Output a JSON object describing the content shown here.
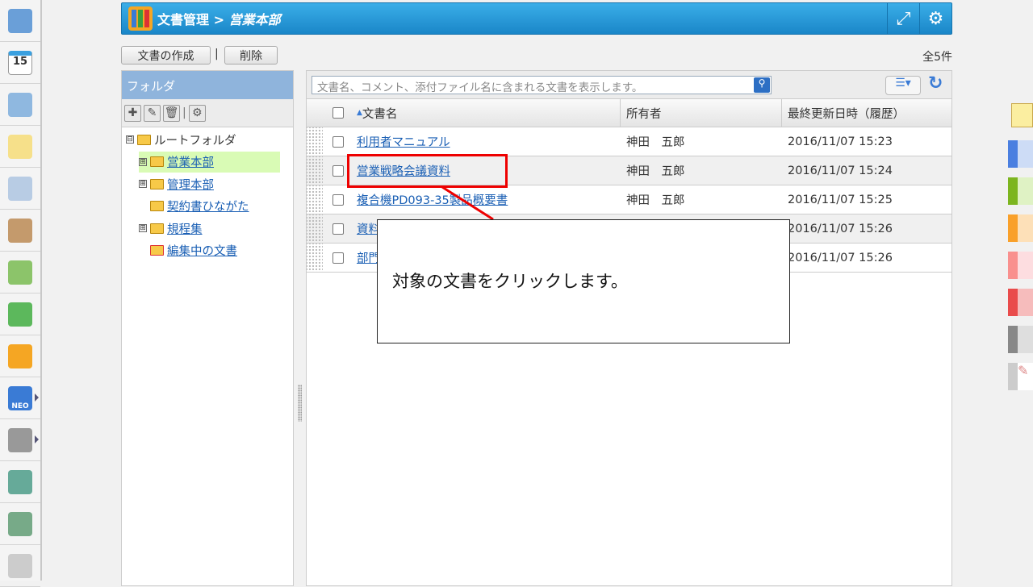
{
  "dock": {
    "icons": [
      "portal-icon",
      "calendar-icon",
      "projector-icon",
      "memo-icon",
      "bulletin-icon",
      "clipboard-icon",
      "todo-icon",
      "workflow-icon",
      "document-binder-icon",
      "neo-icon",
      "folder-icon",
      "nanomail-icon",
      "image-icon",
      "gear-icon"
    ],
    "calendar_day": "15",
    "neo_label": "NEO"
  },
  "header": {
    "app": "文書管理",
    "sep": ">",
    "current": "営業本部"
  },
  "toolbar": {
    "create": "文書の作成",
    "sep": "|",
    "delete": "削除",
    "count": "全5件"
  },
  "folders": {
    "title": "フォルダ",
    "tree": [
      {
        "label": "ルートフォルダ",
        "expander": "⊟"
      },
      {
        "label": "営業本部",
        "expander": "⊞",
        "selected": true
      },
      {
        "label": "管理本部",
        "expander": "⊞"
      },
      {
        "label": "契約書ひながた",
        "expander": ""
      },
      {
        "label": "規程集",
        "expander": "⊞"
      },
      {
        "label": "編集中の文書",
        "expander": ""
      }
    ]
  },
  "list": {
    "search_placeholder": "文書名、コメント、添付ファイル名に含まれる文書を表示します。",
    "columns": [
      "文書名",
      "所有者",
      "最終更新日時（履歴）"
    ],
    "rows": [
      {
        "name": "利用者マニュアル",
        "owner": "神田　五郎",
        "updated": "2016/11/07 15:23"
      },
      {
        "name": "営業戦略会議資料",
        "owner": "神田　五郎",
        "updated": "2016/11/07 15:24"
      },
      {
        "name": "複合機PD093-35製品概要書",
        "owner": "神田　五郎",
        "updated": "2016/11/07 15:25"
      },
      {
        "name": "資料",
        "owner": "",
        "updated": "2016/11/07 15:26"
      },
      {
        "name": "部門",
        "owner": "",
        "updated": "2016/11/07 15:26"
      }
    ]
  },
  "callout": {
    "text": "対象の文書をクリックします。"
  },
  "colors": {
    "header": "#1a86c8",
    "highlight": "#e00000",
    "selected_folder": "#d9fbb5",
    "tabs": [
      "#4a7fe0",
      "#7cb51f",
      "#f9a02a",
      "#f9908e",
      "#e94b4b",
      "#888888"
    ]
  }
}
